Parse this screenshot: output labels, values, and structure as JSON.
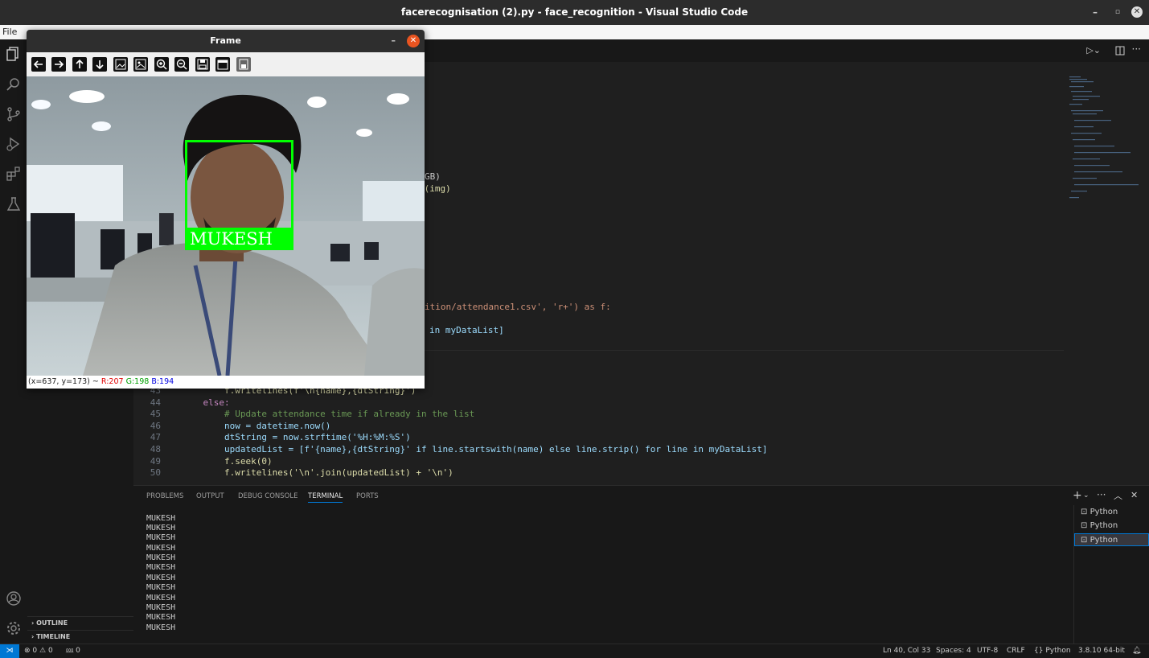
{
  "window": {
    "title": "facerecognisation (2).py - face_recognition - Visual Studio Code"
  },
  "menubar": {
    "file": "File"
  },
  "sidebar": {
    "outline": "OUTLINE",
    "timeline": "TIMELINE"
  },
  "code_fragments": [
    {
      "text": "GB)"
    },
    {
      "text": "s(img)"
    },
    {
      "text": "ition/attendance1.csv', 'r+') as f:"
    },
    {
      "text": "in myDataList]"
    }
  ],
  "code_lines": [
    {
      "num": "43",
      "text": "        f.writelines(f'\\n{name},{dtString}')"
    },
    {
      "num": "44",
      "text": "    else:"
    },
    {
      "num": "45",
      "text": "        # Update attendance time if already in the list"
    },
    {
      "num": "46",
      "text": "        now = datetime.now()"
    },
    {
      "num": "47",
      "text": "        dtString = now.strftime('%H:%M:%S')"
    },
    {
      "num": "48",
      "text": "        updatedList = [f'{name},{dtString}' if line.startswith(name) else line.strip() for line in myDataList]"
    },
    {
      "num": "49",
      "text": "        f.seek(0)"
    },
    {
      "num": "50",
      "text": "        f.writelines('\\n'.join(updatedList) + '\\n')"
    }
  ],
  "panel": {
    "tabs": [
      "PROBLEMS",
      "OUTPUT",
      "DEBUG CONSOLE",
      "TERMINAL",
      "PORTS"
    ],
    "active_tab": "TERMINAL",
    "terminal_lines": [
      "MUKESH",
      "MUKESH",
      "MUKESH",
      "MUKESH",
      "MUKESH",
      "MUKESH",
      "MUKESH",
      "MUKESH",
      "MUKESH",
      "MUKESH",
      "MUKESH",
      "MUKESH"
    ],
    "terminals": [
      "Python",
      "Python",
      "Python"
    ]
  },
  "statusbar": {
    "errors": "0",
    "warnings": "0",
    "ports": "0",
    "position": "Ln 40, Col 33",
    "spaces": "Spaces: 4",
    "encoding": "UTF-8",
    "eol": "CRLF",
    "language": "Python",
    "interpreter": "3.8.10 64-bit"
  },
  "frame": {
    "title": "Frame",
    "face_label": "MUKESH",
    "coords": "(x=637, y=173) ~",
    "r": "R:207",
    "g": "G:198",
    "b": "B:194",
    "toolbar_icons": [
      "pan-left-icon",
      "pan-right-icon",
      "pan-up-icon",
      "pan-down-icon",
      "image-icon",
      "image-alt-icon",
      "zoom-in-icon",
      "zoom-out-icon",
      "save-icon",
      "properties-icon",
      "floppy-icon"
    ]
  },
  "colors": {
    "accent": "#0078d4",
    "detection_box": "#00ff00",
    "status_bar": "#181818"
  }
}
